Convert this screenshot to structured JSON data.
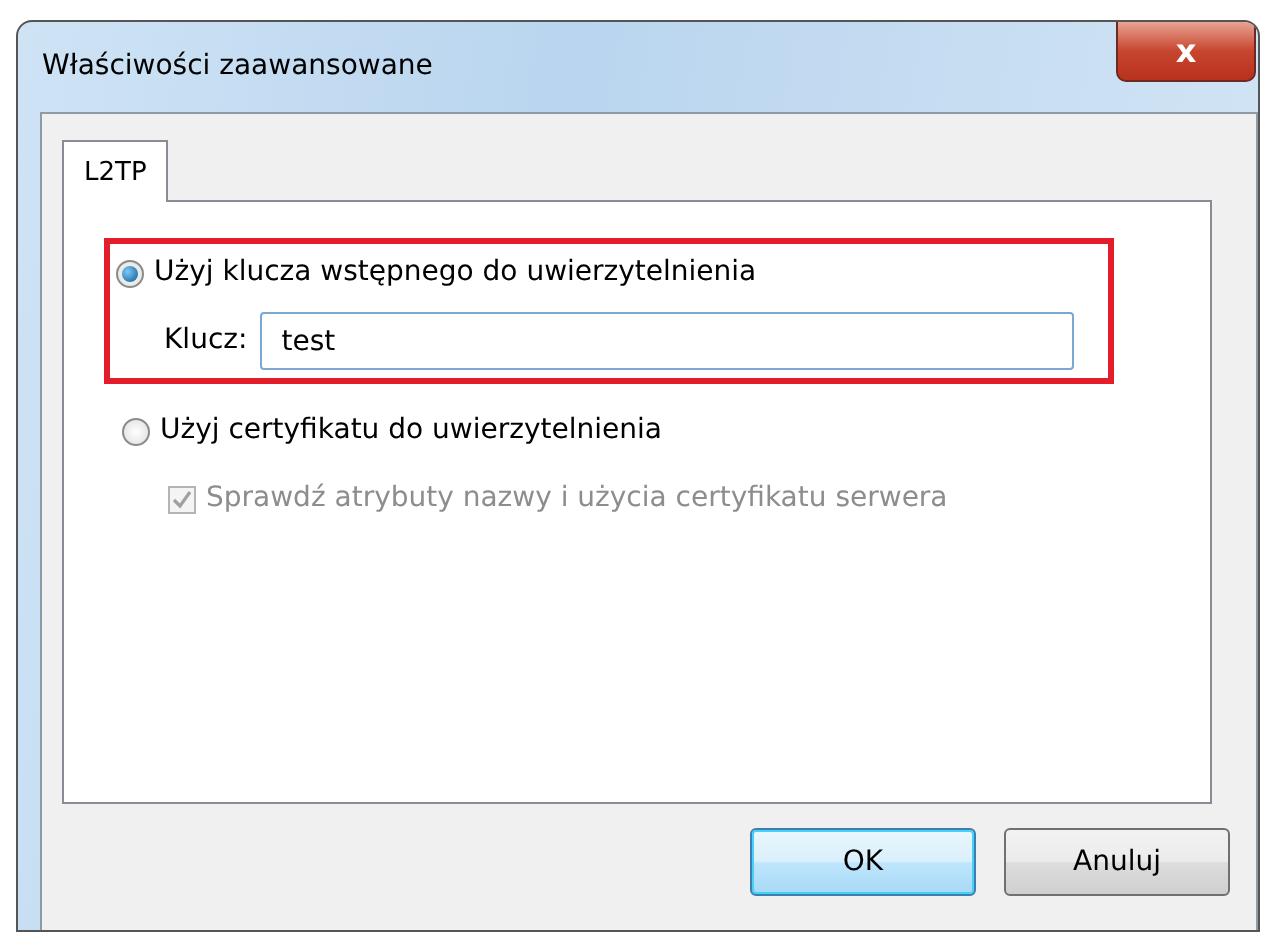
{
  "window": {
    "title": "Właściwości zaawansowane",
    "close_label": "x"
  },
  "tabs": [
    {
      "label": "L2TP",
      "selected": true
    }
  ],
  "options": [
    {
      "kind": "radio",
      "label": "Użyj klucza wstępnego do uwierzytelnienia",
      "selected": true,
      "highlighted": true,
      "field": {
        "label": "Klucz:",
        "value": "test"
      }
    },
    {
      "kind": "radio",
      "label": "Użyj certyfikatu do uwierzytelnienia",
      "selected": false,
      "highlighted": false
    },
    {
      "kind": "checkbox",
      "label": "Sprawdź atrybuty nazwy i użycia certyfikatu serwera",
      "checked": true,
      "disabled": true
    }
  ],
  "buttons": [
    {
      "label": "OK",
      "default": true
    },
    {
      "label": "Anuluj",
      "default": false
    }
  ]
}
